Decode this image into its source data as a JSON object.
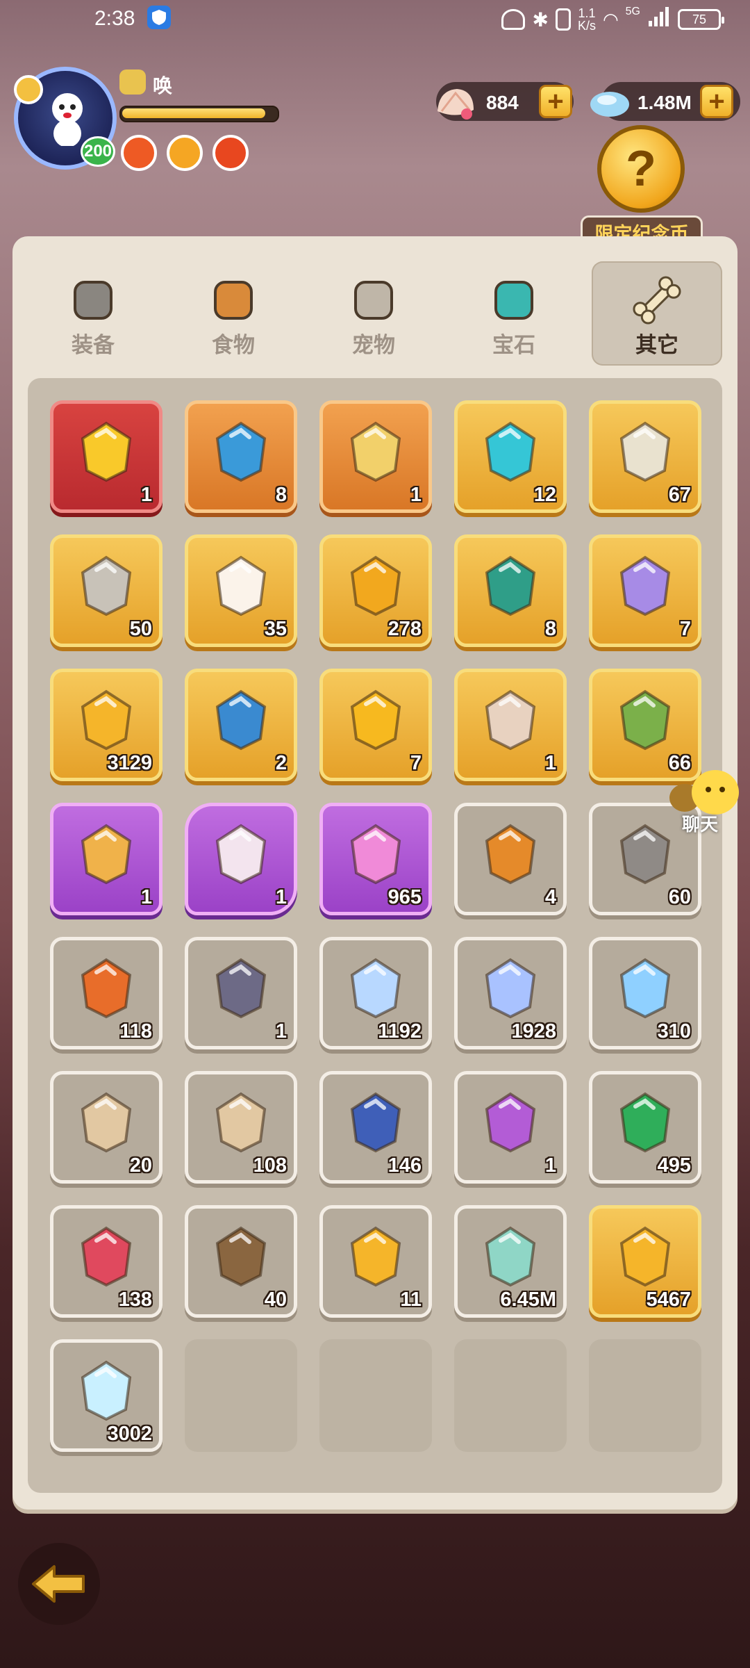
{
  "status_bar": {
    "time": "2:38",
    "net_speed_top": "1.1",
    "net_speed_bottom": "K/s",
    "network": "5G",
    "battery": "75"
  },
  "player": {
    "name": "唤",
    "level": "200",
    "xp_fraction": 0.93
  },
  "currencies": [
    {
      "icon": "shell-icon",
      "value": "884"
    },
    {
      "icon": "crystal-icon",
      "value": "1.48M"
    }
  ],
  "limited_coin": {
    "label": "限定纪念币"
  },
  "tabs": [
    {
      "label": "装备",
      "icon": "hammer-icon",
      "active": false
    },
    {
      "label": "食物",
      "icon": "food-bowl-icon",
      "active": false
    },
    {
      "label": "宠物",
      "icon": "pet-fossil-icon",
      "active": false
    },
    {
      "label": "宝石",
      "icon": "gem-icon",
      "active": false
    },
    {
      "label": "其它",
      "icon": "bone-icon",
      "active": true
    }
  ],
  "items": [
    {
      "icon": "yellow-star-gem-icon",
      "count": "1",
      "frame": "red",
      "color": "#f9c92a"
    },
    {
      "icon": "blue-pouch-cookie-icon",
      "count": "8",
      "frame": "orange",
      "color": "#3a9ad9"
    },
    {
      "icon": "hamster-crystal-icon",
      "count": "1",
      "frame": "orange",
      "color": "#f2d06a"
    },
    {
      "icon": "teal-stone-icon",
      "count": "12",
      "frame": "gold",
      "color": "#35c6d6"
    },
    {
      "icon": "scroll-icon",
      "count": "67",
      "frame": "gold",
      "color": "#e9e2cf"
    },
    {
      "icon": "pickaxe-icon",
      "count": "50",
      "frame": "gold",
      "color": "#c8c2b8"
    },
    {
      "icon": "dice-icon",
      "count": "35",
      "frame": "gold",
      "color": "#fbf3ea"
    },
    {
      "icon": "cake-coin-icon",
      "count": "278",
      "frame": "gold",
      "color": "#f2a81e"
    },
    {
      "icon": "green-pouch-carrot-icon",
      "count": "8",
      "frame": "gold",
      "color": "#2f9e88"
    },
    {
      "icon": "purple-pouch-bunny-icon",
      "count": "7",
      "frame": "gold",
      "color": "#a78be6"
    },
    {
      "icon": "swirl-coin-icon",
      "count": "3129",
      "frame": "gold",
      "color": "#f5b52a"
    },
    {
      "icon": "blue-pouch-gem-icon",
      "count": "2",
      "frame": "gold",
      "color": "#3a8ad0"
    },
    {
      "icon": "golden-egg-icon",
      "count": "7",
      "frame": "gold",
      "color": "#f7b91f"
    },
    {
      "icon": "kid-hood-icon",
      "count": "1",
      "frame": "gold",
      "color": "#e8d2c0"
    },
    {
      "icon": "green-golem-icon",
      "count": "66",
      "frame": "gold",
      "color": "#7bb04a"
    },
    {
      "icon": "character-card-icon",
      "count": "1",
      "frame": "purple",
      "color": "#f0b24a"
    },
    {
      "icon": "old-man-portrait-icon",
      "count": "1",
      "frame": "purple-hex",
      "color": "#f3e4ee"
    },
    {
      "icon": "pink-crystal-icon",
      "count": "965",
      "frame": "purple",
      "color": "#f08ad8"
    },
    {
      "icon": "burger-icon",
      "count": "4",
      "frame": "grey",
      "color": "#e58a2a"
    },
    {
      "icon": "stone-tablet-pen-icon",
      "count": "60",
      "frame": "grey",
      "color": "#8f8a86"
    },
    {
      "icon": "food-platter-icon",
      "count": "118",
      "frame": "grey",
      "color": "#e86d2a"
    },
    {
      "icon": "treasure-chest-icon",
      "count": "1",
      "frame": "grey",
      "color": "#6d6a86"
    },
    {
      "icon": "moon-crystal-icon",
      "count": "1192",
      "frame": "grey",
      "color": "#b8d8ff"
    },
    {
      "icon": "star-crystal-icon",
      "count": "1928",
      "frame": "grey",
      "color": "#a9c2ff"
    },
    {
      "icon": "rainbow-shard-icon",
      "count": "310",
      "frame": "grey",
      "color": "#8fd0ff"
    },
    {
      "icon": "spotted-sack-icon",
      "count": "20",
      "frame": "grey",
      "color": "#e2c8a2"
    },
    {
      "icon": "spotted-sack-icon",
      "count": "108",
      "frame": "grey",
      "color": "#e2c8a2"
    },
    {
      "icon": "blue-rune-stone-icon",
      "count": "146",
      "frame": "grey",
      "color": "#3f5fb8"
    },
    {
      "icon": "purple-dino-ticket-icon",
      "count": "1",
      "frame": "grey",
      "color": "#b35cd6"
    },
    {
      "icon": "green-ticket-icon",
      "count": "495",
      "frame": "grey",
      "color": "#2fae5a"
    },
    {
      "icon": "red-ticket-icon",
      "count": "138",
      "frame": "grey",
      "color": "#e0495e"
    },
    {
      "icon": "brown-play-ticket-icon",
      "count": "40",
      "frame": "grey",
      "color": "#8a6640"
    },
    {
      "icon": "shell-coin-icon",
      "count": "11",
      "frame": "grey",
      "color": "#f5b52a"
    },
    {
      "icon": "jade-stone-icon",
      "count": "6.45M",
      "frame": "grey",
      "color": "#8fd6c6"
    },
    {
      "icon": "gold-medal-coin-icon",
      "count": "5467",
      "frame": "gold",
      "color": "#f5b52a"
    },
    {
      "icon": "rainbow-card-icon",
      "count": "3002",
      "frame": "grey",
      "color": "#c9f0ff"
    },
    {
      "icon": "",
      "count": "",
      "frame": "empty",
      "color": ""
    },
    {
      "icon": "",
      "count": "",
      "frame": "empty",
      "color": ""
    },
    {
      "icon": "",
      "count": "",
      "frame": "empty",
      "color": ""
    },
    {
      "icon": "",
      "count": "",
      "frame": "empty",
      "color": ""
    }
  ],
  "chat": {
    "label": "聊天"
  },
  "back_button": {
    "icon": "back-arrow-icon"
  }
}
